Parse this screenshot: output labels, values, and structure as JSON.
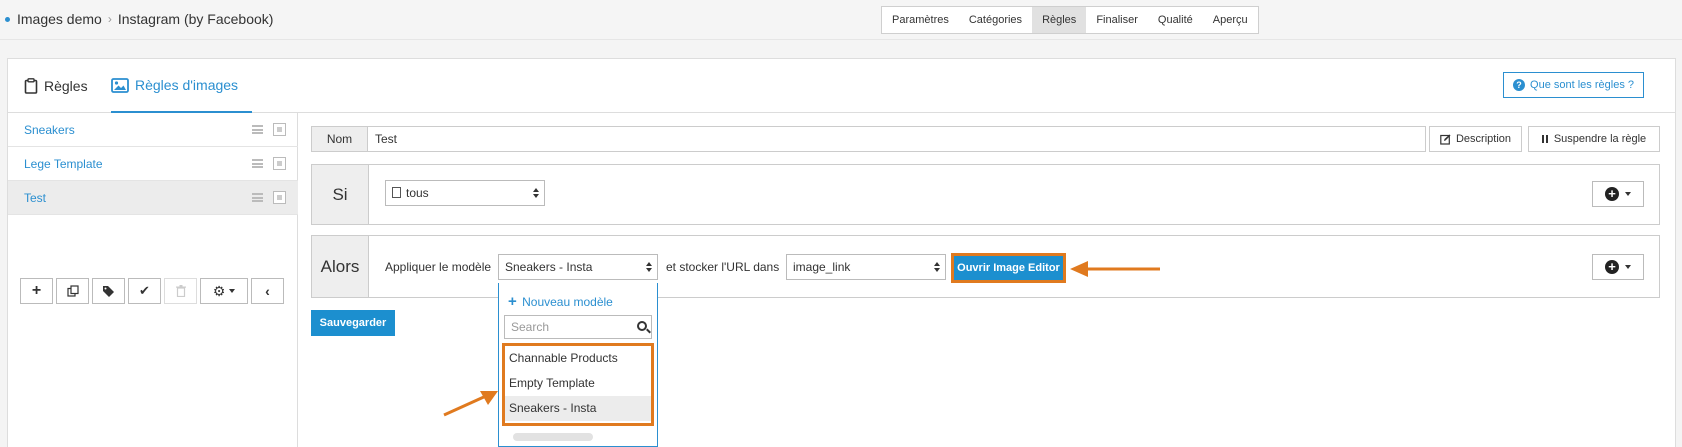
{
  "breadcrumb": {
    "project": "Images demo",
    "channel": "Instagram (by Facebook)"
  },
  "steps": [
    {
      "label": "Paramètres",
      "active": false
    },
    {
      "label": "Catégories",
      "active": false
    },
    {
      "label": "Règles",
      "active": true
    },
    {
      "label": "Finaliser",
      "active": false
    },
    {
      "label": "Qualité",
      "active": false
    },
    {
      "label": "Aperçu",
      "active": false
    }
  ],
  "tabs": {
    "rules": "Règles",
    "image_rules": "Règles d'images"
  },
  "help_button": "Que sont les règles ?",
  "rule_list": [
    "Sneakers",
    "Lege Template",
    "Test"
  ],
  "selected_rule": "Test",
  "rule_name": {
    "label": "Nom",
    "value": "Test"
  },
  "buttons": {
    "description": "Description",
    "suspend": "Suspendre la règle",
    "open_editor": "Ouvrir Image Editor",
    "save": "Sauvegarder"
  },
  "condition": {
    "label": "Si",
    "select_value": "tous"
  },
  "action": {
    "label": "Alors",
    "apply_text": "Appliquer le modèle",
    "template_value": "Sneakers - Insta",
    "store_text": "et stocker l'URL dans",
    "field_value": "image_link"
  },
  "dropdown": {
    "new_template": "Nouveau modèle",
    "search_placeholder": "Search",
    "options": [
      "Channable Products",
      "Empty Template",
      "Sneakers - Insta"
    ],
    "highlighted": "Sneakers - Insta"
  },
  "colors": {
    "accent": "#1c8fcf",
    "highlight": "#e07a1f"
  }
}
